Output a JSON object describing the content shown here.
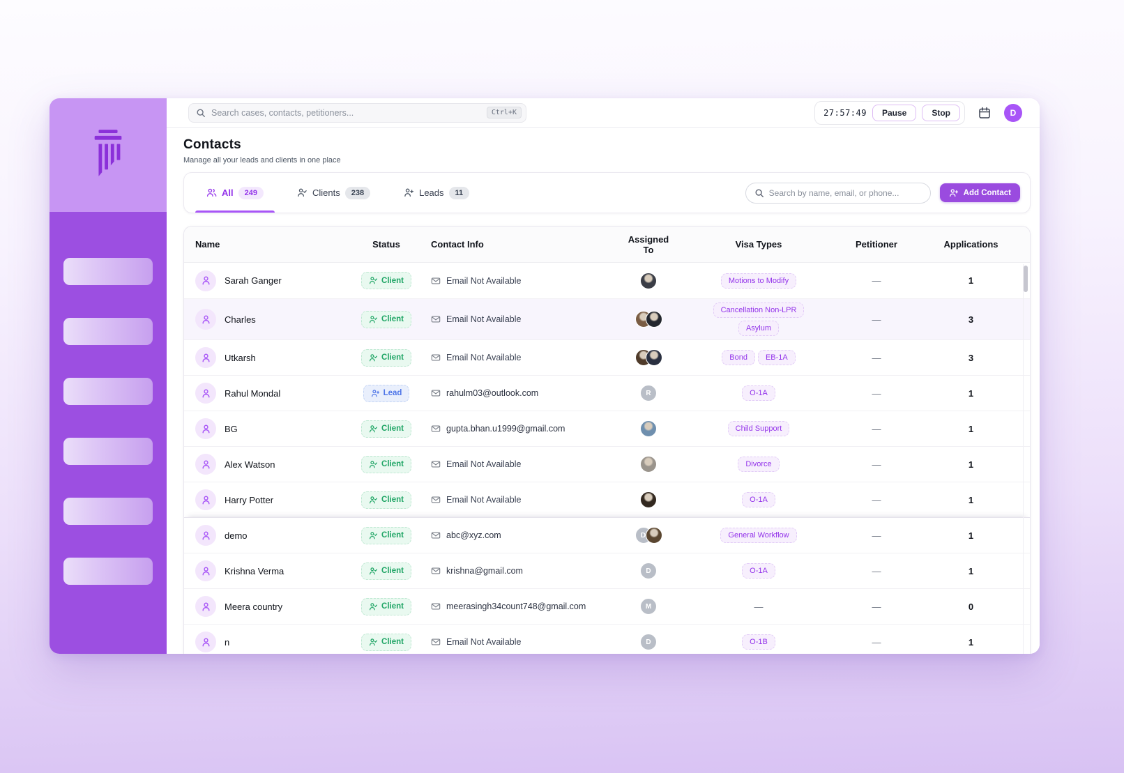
{
  "topbar": {
    "global_search_placeholder": "Search cases, contacts, petitioners...",
    "shortcut": "Ctrl+K",
    "timer": "27:57:49",
    "pause_label": "Pause",
    "stop_label": "Stop",
    "avatar_initial": "D"
  },
  "page": {
    "title": "Contacts",
    "subtitle": "Manage all your leads and clients in one place"
  },
  "tabs": [
    {
      "label": "All",
      "count": "249",
      "active": true,
      "icon": "users-icon"
    },
    {
      "label": "Clients",
      "count": "238",
      "active": false,
      "icon": "person-check-icon"
    },
    {
      "label": "Leads",
      "count": "11",
      "active": false,
      "icon": "person-plus-icon"
    }
  ],
  "toolbar": {
    "search_placeholder": "Search by name, email, or phone...",
    "add_contact_label": "Add Contact"
  },
  "table": {
    "columns": [
      "Name",
      "Status",
      "Contact Info",
      "Assigned To",
      "Visa Types",
      "Petitioner",
      "Applications"
    ],
    "rows": [
      {
        "name": "Sarah Ganger",
        "status": "Client",
        "email": "Email Not Available",
        "assignees": [
          {
            "kind": "photo",
            "tone": "#3a3d46"
          }
        ],
        "visas": [
          "Motions to Modify"
        ],
        "petitioner": "—",
        "applications": "1",
        "highlighted": false,
        "shadow_top": false
      },
      {
        "name": "Charles",
        "status": "Client",
        "email": "Email Not Available",
        "assignees": [
          {
            "kind": "photo",
            "tone": "#7a5c44"
          },
          {
            "kind": "photo",
            "tone": "#23262e"
          }
        ],
        "visas": [
          "Cancellation Non-LPR",
          "Asylum"
        ],
        "petitioner": "—",
        "applications": "3",
        "highlighted": true,
        "shadow_top": false
      },
      {
        "name": "Utkarsh",
        "status": "Client",
        "email": "Email Not Available",
        "assignees": [
          {
            "kind": "photo",
            "tone": "#4f3b2a"
          },
          {
            "kind": "photo",
            "tone": "#2a3040"
          }
        ],
        "visas": [
          "Bond",
          "EB-1A"
        ],
        "petitioner": "—",
        "applications": "3",
        "highlighted": false,
        "shadow_top": false
      },
      {
        "name": "Rahul Mondal",
        "status": "Lead",
        "email": "rahulm03@outlook.com",
        "assignees": [
          {
            "kind": "initial",
            "label": "R"
          }
        ],
        "visas": [
          "O-1A"
        ],
        "petitioner": "—",
        "applications": "1",
        "highlighted": false,
        "shadow_top": false
      },
      {
        "name": "BG",
        "status": "Client",
        "email": "gupta.bhan.u1999@gmail.com",
        "assignees": [
          {
            "kind": "photo",
            "tone": "#6f8fae"
          }
        ],
        "visas": [
          "Child Support"
        ],
        "petitioner": "—",
        "applications": "1",
        "highlighted": false,
        "shadow_top": false
      },
      {
        "name": "Alex Watson",
        "status": "Client",
        "email": "Email Not Available",
        "assignees": [
          {
            "kind": "photo",
            "tone": "#9a948c"
          }
        ],
        "visas": [
          "Divorce"
        ],
        "petitioner": "—",
        "applications": "1",
        "highlighted": false,
        "shadow_top": false
      },
      {
        "name": "Harry Potter",
        "status": "Client",
        "email": "Email Not Available",
        "assignees": [
          {
            "kind": "photo",
            "tone": "#32281f"
          }
        ],
        "visas": [
          "O-1A"
        ],
        "petitioner": "—",
        "applications": "1",
        "highlighted": false,
        "shadow_top": false
      },
      {
        "name": "demo",
        "status": "Client",
        "email": "abc@xyz.com",
        "assignees": [
          {
            "kind": "initial",
            "label": "D"
          },
          {
            "kind": "photo",
            "tone": "#5a4630"
          }
        ],
        "visas": [
          "General Workflow"
        ],
        "petitioner": "—",
        "applications": "1",
        "highlighted": false,
        "shadow_top": true
      },
      {
        "name": "Krishna Verma",
        "status": "Client",
        "email": "krishna@gmail.com",
        "assignees": [
          {
            "kind": "initial",
            "label": "D"
          }
        ],
        "visas": [
          "O-1A"
        ],
        "petitioner": "—",
        "applications": "1",
        "highlighted": false,
        "shadow_top": false
      },
      {
        "name": "Meera country",
        "status": "Client",
        "email": "meerasingh34count748@gmail.com",
        "assignees": [
          {
            "kind": "initial",
            "label": "M"
          }
        ],
        "visas": [],
        "visa_empty": "—",
        "petitioner": "—",
        "applications": "0",
        "highlighted": false,
        "shadow_top": false
      },
      {
        "name": "n",
        "status": "Client",
        "email": "Email Not Available",
        "assignees": [
          {
            "kind": "initial",
            "label": "D"
          }
        ],
        "visas": [
          "O-1B"
        ],
        "petitioner": "—",
        "applications": "1",
        "highlighted": false,
        "shadow_top": false
      }
    ]
  },
  "colors": {
    "accent_purple": "#9a4bdf",
    "sidebar_purple": "#9c4fe1",
    "sidebar_logo_panel": "#c795f3",
    "client_badge_text": "#1fa565",
    "lead_badge_text": "#4f76e8",
    "visa_badge_text": "#9333ea"
  }
}
